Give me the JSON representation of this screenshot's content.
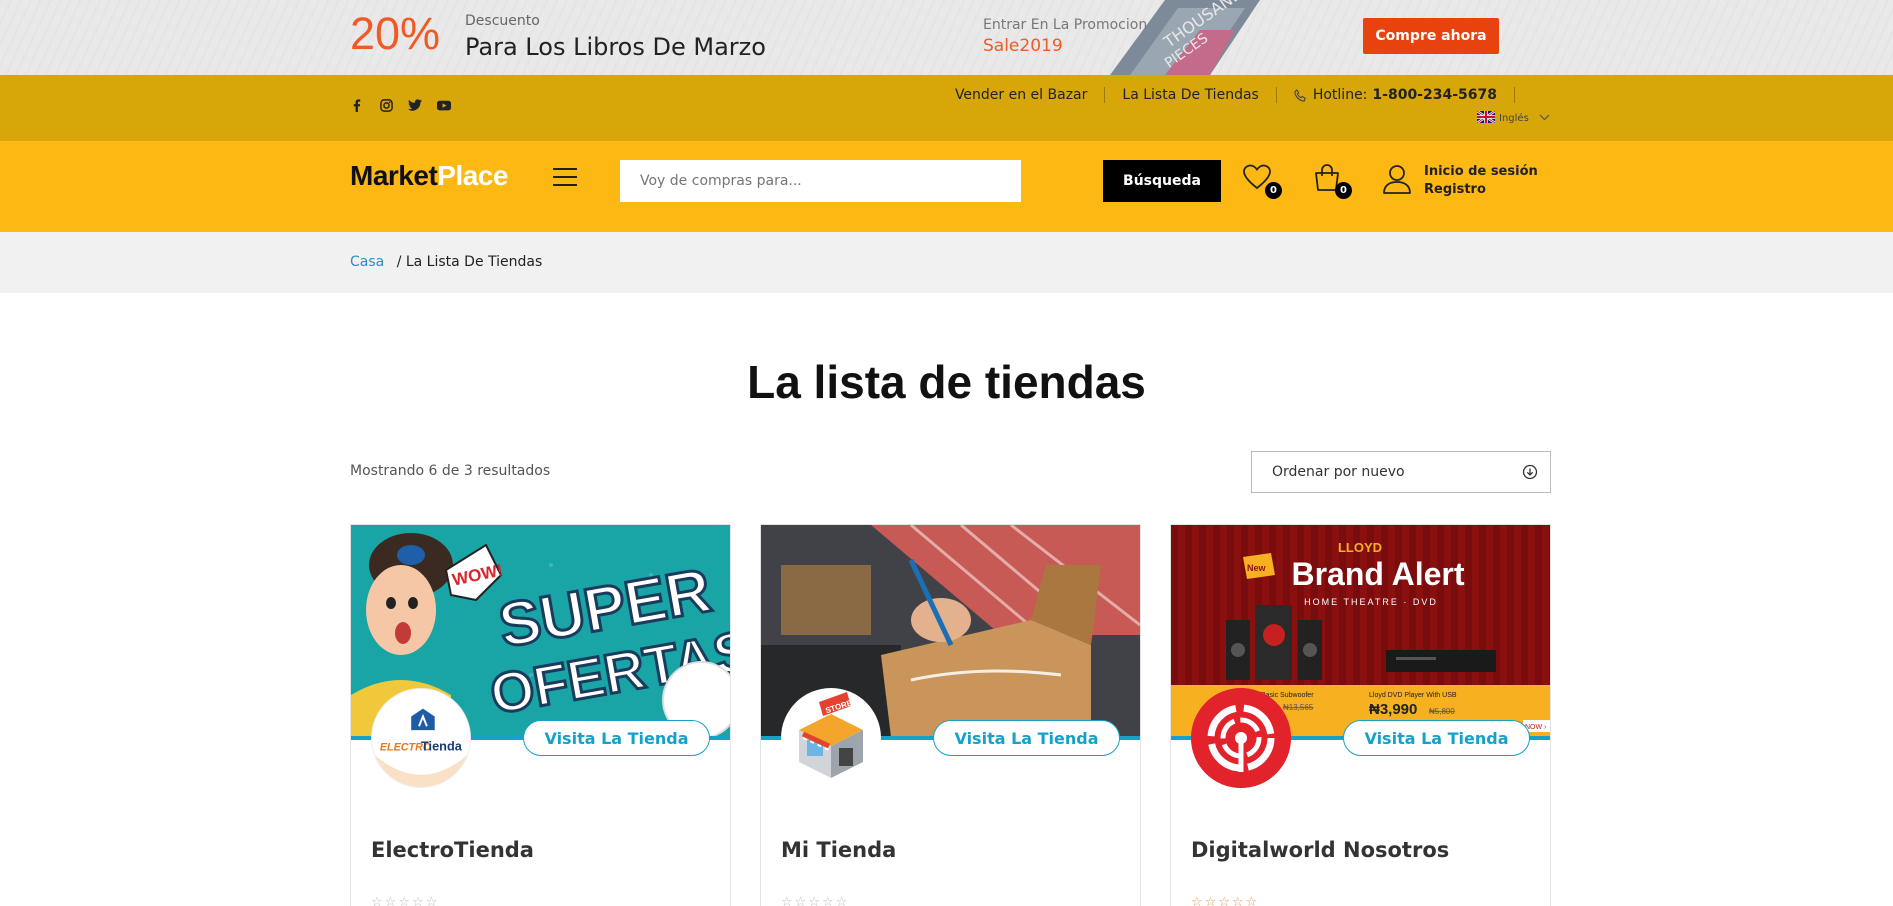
{
  "promo": {
    "percent": "20%",
    "small": "Descuento",
    "big": "Para Los Libros De Marzo",
    "enter": "Entrar En La Promocion",
    "code": "Sale2019",
    "button": "Compre ahora"
  },
  "topbar": {
    "social": [
      "facebook-icon",
      "instagram-icon",
      "twitter-icon",
      "youtube-icon"
    ],
    "sell": "Vender en el Bazar",
    "stores": "La Lista De Tiendas",
    "hotline_label": "Hotline:",
    "hotline_number": "1-800-234-5678",
    "language": "Inglés"
  },
  "header": {
    "logo_a": "Market",
    "logo_b": "Place",
    "search_placeholder": "Voy de compras para...",
    "search_button": "Búsqueda",
    "wishlist_count": "0",
    "cart_count": "0",
    "login": "Inicio de sesión",
    "register": "Registro"
  },
  "breadcrumb": {
    "home": "Casa",
    "current": "/ La Lista De Tiendas"
  },
  "page": {
    "title": "La lista de tiendas",
    "results": "Mostrando 6 de 3 resultados",
    "sort": "Ordenar por nuevo"
  },
  "cards": [
    {
      "name": "ElectroTienda",
      "visit": "Visita La Tienda",
      "banner_line1": "SUPER",
      "banner_line2": "OFERTAS",
      "bubble": "WOW!",
      "logo_a": "ELECTRO",
      "logo_b": "Tienda"
    },
    {
      "name": "Mi Tienda",
      "visit": "Visita La Tienda",
      "badge": "STORE"
    },
    {
      "name": "Digitalworld Nosotros",
      "visit": "Visita La Tienda",
      "brand": "LLOYD",
      "headline": "Brand Alert",
      "sub": "HOME THEATRE · DVD",
      "new": "New",
      "item1": "Basic Subwoofer",
      "price1_old": "₦13,565",
      "item2": "Lloyd DVD Player With USB",
      "price2": "₦3,990",
      "price2_old": "₦5,800",
      "shop": "NOW ›"
    }
  ],
  "colors": {
    "accent": "#fdb813",
    "topbar": "#d7a70a",
    "promo_orange": "#f15a24",
    "link_blue": "#16a2c8"
  }
}
